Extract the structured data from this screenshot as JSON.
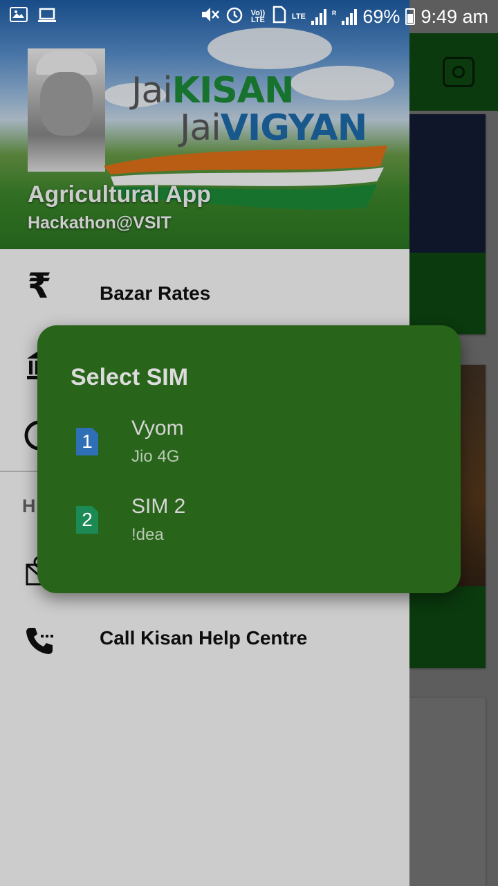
{
  "status_bar": {
    "time": "9:49 am",
    "battery": "69%",
    "network_small": "LTE",
    "volte": "Vo)) LTE",
    "roaming": "R",
    "icons": [
      "image-icon",
      "laptop-icon",
      "mute-icon",
      "alarm-icon",
      "volte-icon",
      "sim-icon",
      "lte-icon",
      "signal-icon",
      "signal-roaming-icon",
      "battery-icon"
    ]
  },
  "drawer": {
    "header": {
      "logo_line1_a": "Jai",
      "logo_line1_b": "KISAN",
      "logo_line2_a": "Jai",
      "logo_line2_b": "VIGYAN",
      "title": "Agricultural App",
      "subtitle": "Hackathon@VSIT"
    },
    "items": [
      {
        "label": "Bazar Rates",
        "icon": "rupee-icon"
      },
      {
        "label": "",
        "icon": "bank-icon"
      },
      {
        "label": "",
        "icon": "currency-icon"
      },
      {
        "label": "",
        "icon": "mail-icon"
      },
      {
        "label": "Call Kisan Help Centre",
        "icon": "phone-icon"
      }
    ],
    "section_header": "H"
  },
  "dialog": {
    "title": "Select SIM",
    "sims": [
      {
        "slot": "1",
        "name": "Vyom",
        "carrier": "Jio 4G",
        "color": "#2f6fb5"
      },
      {
        "slot": "2",
        "name": "SIM 2",
        "carrier": "!dea",
        "color": "#1c8a55"
      }
    ]
  },
  "colors": {
    "app_green": "#1f9a27",
    "dialog_bg": "#28641a"
  }
}
